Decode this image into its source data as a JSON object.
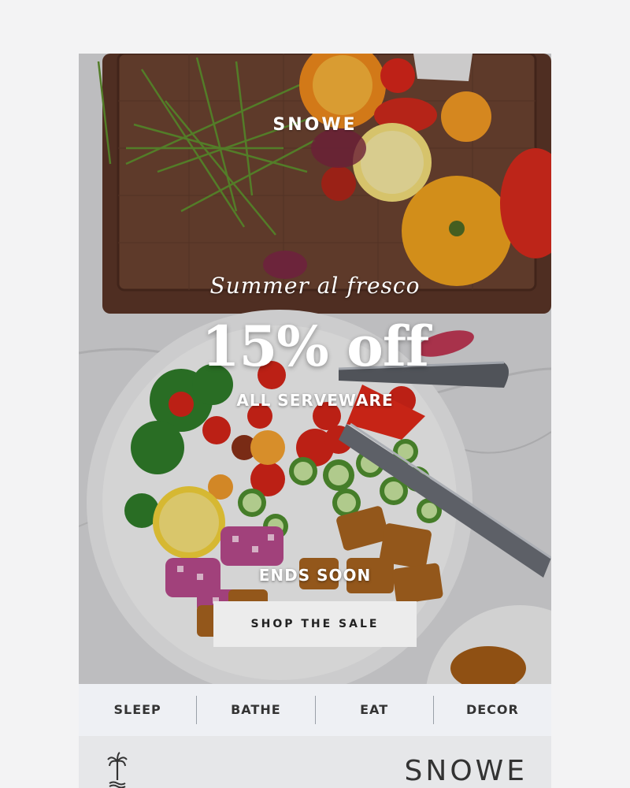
{
  "hero": {
    "brand": "SNOWE",
    "tagline": "Summer al fresco",
    "headline": "15% off",
    "subline": "ALL SERVEWARE",
    "ends": "ENDS SOON",
    "cta_label": "SHOP THE SALE"
  },
  "nav": {
    "items": [
      {
        "label": "SLEEP"
      },
      {
        "label": "BATHE"
      },
      {
        "label": "EAT"
      },
      {
        "label": "DECOR"
      }
    ]
  },
  "footer": {
    "brand": "SNOWE",
    "logo_icon": "palm-tree-icon"
  },
  "colors": {
    "background": "#f3f3f4",
    "nav_background": "#eef0f4",
    "footer_background": "#e6e7e9",
    "cta_background": "#ececec",
    "text_dark": "#333333"
  }
}
